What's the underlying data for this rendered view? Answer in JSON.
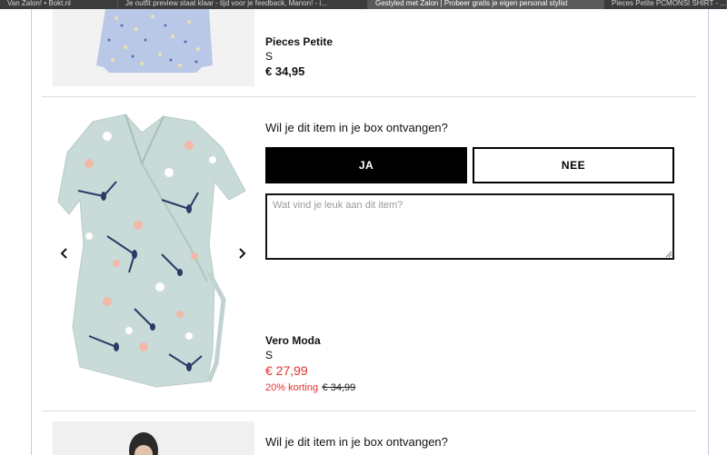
{
  "browser": {
    "tabs": [
      {
        "label": "Van Zalon! • Bokt.nl",
        "active": false
      },
      {
        "label": "Je outfit preview staat klaar - tijd voor je feedback, Manon! - i...",
        "active": false
      },
      {
        "label": "Gestyled met Zalon | Probeer gratis je eigen personal stylist",
        "active": true
      },
      {
        "label": "Pieces Petite PCMONSI SHIRT - ...",
        "active": false
      }
    ]
  },
  "items": [
    {
      "brand": "Pieces Petite",
      "size": "S",
      "price": "€ 34,95",
      "image": "blue-floral-blouse"
    },
    {
      "question": "Wil je dit item in je box ontvangen?",
      "yes_label": "JA",
      "no_label": "NEE",
      "comment_placeholder": "Wat vind je leuk aan dit item?",
      "brand": "Vero Moda",
      "size": "S",
      "price": "€ 27,99",
      "discount": "20% korting",
      "old_price": "€ 34,99",
      "image": "mint-floral-wrap-top"
    },
    {
      "question": "Wil je dit item in je box ontvangen?",
      "image": "model-photo"
    }
  ],
  "icons": {
    "prev": "chevron-left-icon",
    "next": "chevron-right-icon"
  },
  "colors": {
    "sale_red": "#e2312b",
    "button_black": "#000000",
    "divider": "#dcdcdc"
  }
}
